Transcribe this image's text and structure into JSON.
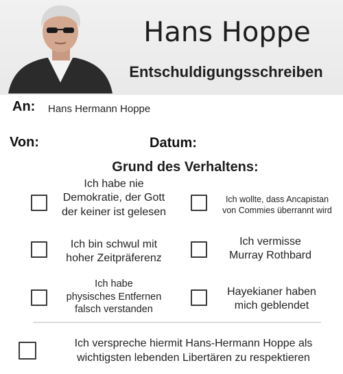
{
  "header": {
    "title": "Hans Hoppe",
    "subtitle": "Entschuldigungsschreiben"
  },
  "fields": {
    "to_label": "An:",
    "to_value": "Hans Hermann Hoppe",
    "from_label": "Von:",
    "date_label": "Datum:"
  },
  "reasons": {
    "title": "Grund des Verhaltens:",
    "options": [
      {
        "lines": [
          "Ich habe nie",
          "Demokratie, der Gott",
          "der keiner ist gelesen"
        ],
        "checked": false
      },
      {
        "lines": [
          "Ich wollte, dass Ancapistan",
          "von Commies überrannt wird"
        ],
        "checked": false
      },
      {
        "lines": [
          "Ich bin schwul mit",
          "hoher Zeitpräferenz"
        ],
        "checked": false
      },
      {
        "lines": [
          "Ich vermisse",
          "Murray Rothbard"
        ],
        "checked": false
      },
      {
        "lines": [
          "Ich habe",
          "physisches Entfernen",
          "falsch verstanden"
        ],
        "checked": false
      },
      {
        "lines": [
          "Hayekianer haben",
          "mich geblendet"
        ],
        "checked": false
      }
    ]
  },
  "pledge": {
    "lines": [
      "Ich verspreche hiermit Hans-Hermann Hoppe als",
      "wichtigsten lebenden Libertären zu respektieren"
    ],
    "checked": false
  }
}
